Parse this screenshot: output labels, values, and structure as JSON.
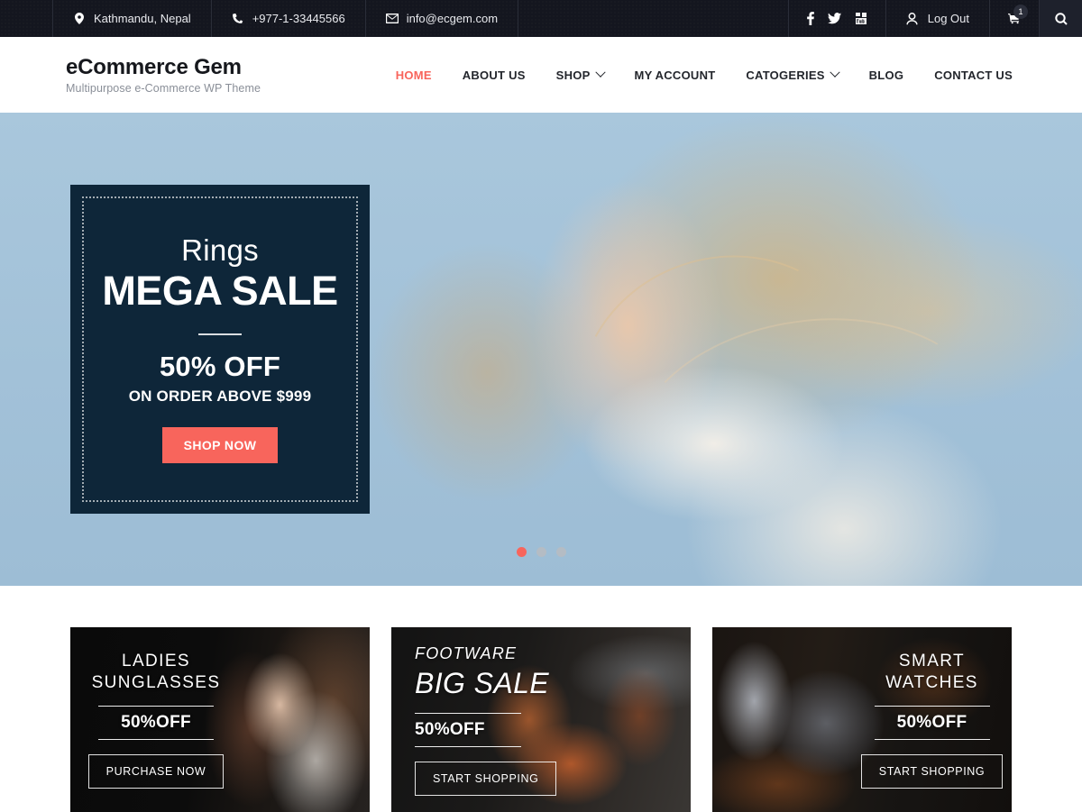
{
  "topbar": {
    "location": "Kathmandu, Nepal",
    "phone": "+977-1-33445566",
    "email": "info@ecgem.com",
    "social": [
      {
        "name": "facebook-icon",
        "label": "Facebook"
      },
      {
        "name": "twitter-icon",
        "label": "Twitter"
      },
      {
        "name": "youtube-icon",
        "label": "YouTube"
      }
    ],
    "account_label": "Log Out",
    "cart_count": "1",
    "search_label": "Search"
  },
  "header": {
    "brand_title": "eCommerce Gem",
    "brand_subtitle": "Multipurpose e-Commerce WP Theme",
    "nav": [
      {
        "label": "HOME",
        "active": true,
        "caret": false
      },
      {
        "label": "ABOUT US",
        "active": false,
        "caret": false
      },
      {
        "label": "SHOP",
        "active": false,
        "caret": true
      },
      {
        "label": "MY ACCOUNT",
        "active": false,
        "caret": false
      },
      {
        "label": "CATOGERIES",
        "active": false,
        "caret": true
      },
      {
        "label": "BLOG",
        "active": false,
        "caret": false
      },
      {
        "label": "CONTACT US",
        "active": false,
        "caret": false
      }
    ]
  },
  "hero": {
    "promo": {
      "kicker": "Rings",
      "title": "MEGA SALE",
      "discount": "50% OFF",
      "condition": "ON ORDER ABOVE $999",
      "button_label": "SHOP NOW"
    },
    "slides": [
      {
        "index": "1",
        "active": true
      },
      {
        "index": "2",
        "active": false
      },
      {
        "index": "3",
        "active": false
      }
    ]
  },
  "cards": [
    {
      "kicker": "LADIES",
      "title": "SUNGLASSES",
      "discount": "50%OFF",
      "button_label": "PURCHASE NOW"
    },
    {
      "kicker": "FOOTWARE",
      "title": "BIG SALE",
      "discount": "50%OFF",
      "button_label": "START SHOPPING"
    },
    {
      "kicker": "SMART",
      "title": "WATCHES",
      "discount": "50%OFF",
      "button_label": "START SHOPPING"
    }
  ],
  "colors": {
    "accent": "#f8655c",
    "topbar_bg": "#14161f",
    "promo_bg": "#0e2639",
    "hero_bg": "#a4c4da",
    "nav_text": "#23262c"
  }
}
